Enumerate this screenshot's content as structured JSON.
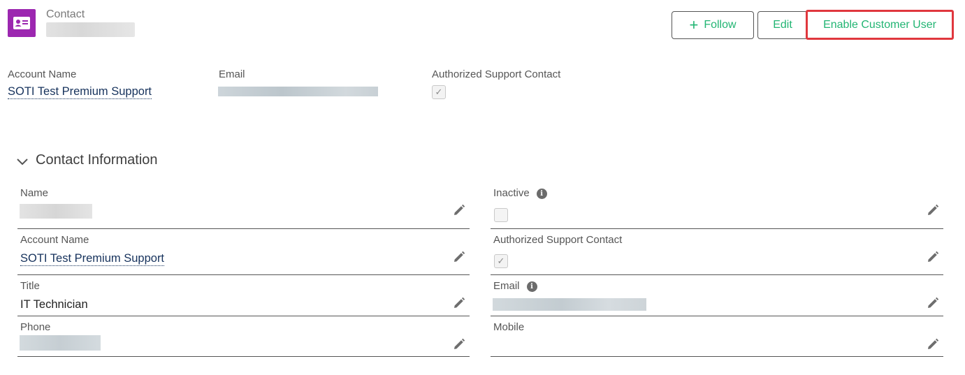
{
  "header": {
    "object_type": "Contact",
    "icon": "contact-card-icon",
    "buttons": {
      "follow": "Follow",
      "edit": "Edit",
      "enable_customer_user": "Enable Customer User"
    }
  },
  "summary": {
    "account_name_label": "Account Name",
    "account_name_value": "SOTI Test Premium Support",
    "email_label": "Email",
    "authorized_label": "Authorized Support Contact",
    "authorized_checked": true
  },
  "section": {
    "title": "Contact Information",
    "left": [
      {
        "label": "Name",
        "value": ""
      },
      {
        "label": "Account Name",
        "value": "SOTI Test Premium Support"
      },
      {
        "label": "Title",
        "value": "IT Technician"
      },
      {
        "label": "Phone",
        "value": ""
      }
    ],
    "right": [
      {
        "label": "Inactive",
        "checked": false
      },
      {
        "label": "Authorized Support Contact",
        "checked": true
      },
      {
        "label": "Email",
        "value": ""
      },
      {
        "label": "Mobile",
        "value": ""
      }
    ]
  },
  "colors": {
    "accent_green": "#22b573",
    "brand_purple": "#9c27b0",
    "highlight_red": "#e0373e",
    "link_navy": "#16325c"
  }
}
